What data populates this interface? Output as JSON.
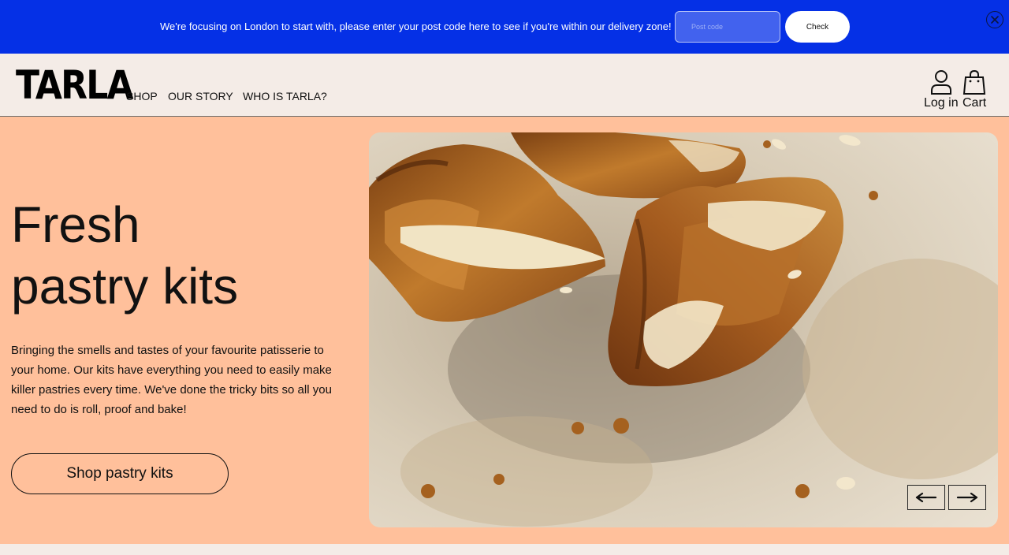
{
  "banner": {
    "message": "We're focusing on London to start with, please enter your post code here to see if you're within our delivery zone!",
    "postcode_placeholder": "Post code",
    "postcode_value": "",
    "check_label": "Check"
  },
  "header": {
    "logo": "TARLA",
    "nav": [
      "SHOP",
      "OUR STORY",
      "WHO IS TARLA?"
    ],
    "login_label": "Log in",
    "cart_label": "Cart"
  },
  "hero": {
    "title_line1": "Fresh",
    "title_line2": "pastry kits",
    "description": "Bringing the smells and tastes of your favourite patisserie to your home. Our kits have everything you need to easily make killer pastries every time. We've done the tricky bits so all you need to do is roll, proof and bake!",
    "cta_label": "Shop pastry kits"
  },
  "colors": {
    "banner_bg": "#0530e6",
    "header_bg": "#f4ece7",
    "hero_bg": "#ffc09b"
  },
  "icons": {
    "close": "close-circle-icon",
    "login": "user-icon",
    "cart": "shopping-bag-icon",
    "prev": "arrow-left-icon",
    "next": "arrow-right-icon"
  }
}
